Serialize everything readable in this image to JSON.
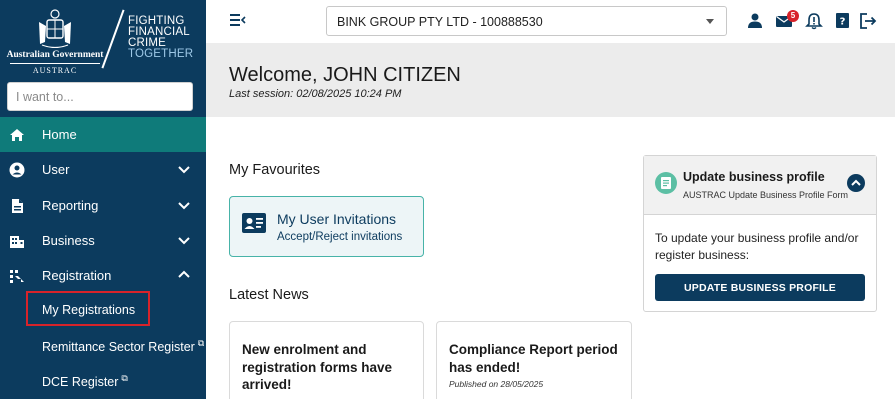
{
  "logo": {
    "government": "Australian Government",
    "agency": "AUSTRAC",
    "tagline_lines": [
      "FIGHTING",
      "FINANCIAL",
      "CRIME",
      "TOGETHER"
    ]
  },
  "search": {
    "placeholder": "I want to..."
  },
  "sidebar": {
    "items": [
      {
        "label": "Home",
        "icon": "home-icon",
        "active": true
      },
      {
        "label": "User",
        "icon": "user-circle-icon",
        "expand": "down"
      },
      {
        "label": "Reporting",
        "icon": "document-icon",
        "expand": "down"
      },
      {
        "label": "Business",
        "icon": "building-icon",
        "expand": "down"
      },
      {
        "label": "Registration",
        "icon": "registration-icon",
        "expand": "up"
      }
    ],
    "sub_items": [
      {
        "label": "My Registrations",
        "highlighted": true
      },
      {
        "label": "Remittance Sector Register",
        "external": true
      },
      {
        "label": "DCE Register",
        "external": true
      }
    ]
  },
  "topbar": {
    "entity": "BINK GROUP PTY LTD - 100888530",
    "mail_badge": "5",
    "icons": [
      "menu-icon",
      "person-icon",
      "mail-icon",
      "bell-alert-icon",
      "help-icon",
      "logout-icon"
    ]
  },
  "welcome": {
    "title": "Welcome, JOHN CITIZEN",
    "last_session": "Last session: 02/08/2025 10:24 PM"
  },
  "favourites": {
    "heading": "My Favourites",
    "card": {
      "title": "My User Invitations",
      "subtitle": "Accept/Reject invitations"
    }
  },
  "news": {
    "heading": "Latest News",
    "items": [
      {
        "title": "New enrolment and registration forms have arrived!",
        "date": ""
      },
      {
        "title": "Compliance Report period has ended!",
        "date": "Published on 28/05/2025"
      }
    ]
  },
  "profile": {
    "title": "Update business profile",
    "subtitle": "AUSTRAC Update Business Profile Form",
    "body": "To update your business profile and/or register business:",
    "button": "UPDATE BUSINESS PROFILE"
  },
  "colors": {
    "sidebar_bg": "#0c3b5e",
    "active_bg": "#0f7b7a",
    "accent_red": "#d8232a",
    "teal_border": "#47b3a8"
  }
}
